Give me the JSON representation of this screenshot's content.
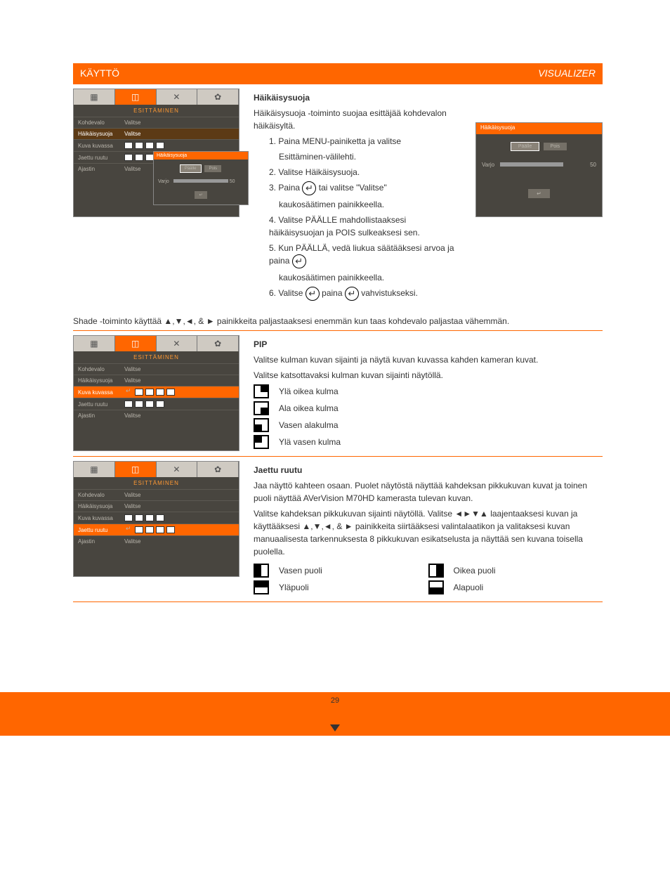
{
  "header": {
    "left": "KÄYTTÖ",
    "right": "VISUALIZER"
  },
  "section1": {
    "title": "Häikäisysuoja",
    "intro": "Häikäisysuoja -toiminto suojaa esittäjää kohdevalon häikäisyltä.",
    "steps": [
      "Paina MENU-painiketta ja valitse",
      "Esittäminen-välilehti.",
      "Valitse Häikäisysuoja.",
      "Paina",
      "tai valitse \"Valitse\"",
      "kaukosäätimen painikkeella.",
      "Valitse PÄÄLLE mahdollistaaksesi häikäisysuojan ja POIS sulkeaksesi sen.",
      "Kun PÄÄLLÄ, vedä liukua säätääksesi arvoa ja paina",
      "kaukosäätimen painikkeella.",
      "Valitse",
      "paina",
      "vahvistukseksi."
    ],
    "shade_note": "Shade -toiminto käyttää ▲,▼,◄, & ► painikkeita paljastaaksesi enemmän kun taas kohdevalo paljastaa vähemmän.",
    "panel_main": {
      "menu_title": "ESITTÄMINEN",
      "rows": [
        {
          "label": "Kohdevalo",
          "val": "Valitse"
        },
        {
          "label": "Häikäisysuoja",
          "val": "Valitse"
        },
        {
          "label": "Kuva kuvassa",
          "val": ""
        },
        {
          "label": "Jaettu ruutu",
          "val": ""
        },
        {
          "label": "Ajastin",
          "val": "Valitse"
        }
      ]
    },
    "popup": {
      "hdr": "Häikäisysuoja",
      "on": "Päälle",
      "off": "Pois",
      "shade_label": "Varjo",
      "shade_val": "50"
    },
    "large_popup": {
      "hdr": "Häikäisysuoja",
      "on": "Päälle",
      "off": "Pois",
      "shade_label": "Varjo",
      "shade_val": "50"
    }
  },
  "section2": {
    "title": "PIP",
    "p1": "Valitse kulman kuvan sijainti ja näytä kuvan kuvassa kahden kameran kuvat.",
    "p2": "Valitse katsottavaksi kulman kuvan sijainti näytöllä.",
    "li": [
      "Ylä oikea kulma",
      "Ala oikea kulma",
      "Vasen alakulma",
      "Ylä vasen kulma"
    ],
    "panel_main": {
      "menu_title": "ESITTÄMINEN",
      "rows": [
        {
          "label": "Kohdevalo",
          "val": "Valitse"
        },
        {
          "label": "Häikäisysuoja",
          "val": "Valitse"
        },
        {
          "label": "Kuva kuvassa",
          "val": ""
        },
        {
          "label": "Jaettu ruutu",
          "val": ""
        },
        {
          "label": "Ajastin",
          "val": "Valitse"
        }
      ]
    }
  },
  "section3": {
    "title": "Jaettu ruutu",
    "p1": "Jaa näyttö kahteen osaan. Puolet näytöstä näyttää kahdeksan pikkukuvan kuvat ja toinen puoli näyttää AVerVision M70HD kamerasta tulevan kuvan.",
    "p2": "Valitse kahdeksan pikkukuvan sijainti näytöllä. Valitse ◄►▼▲ laajentaaksesi kuvan ja käyttääksesi ▲,▼,◄, & ► painikkeita siirtääksesi valintalaatikon ja valitaksesi kuvan manuaalisesta tarkennuksesta 8 pikkukuvan esikatselusta ja näyttää sen kuvana toisella puolella.",
    "li": [
      "Vasen puoli",
      "Yläpuoli",
      "Oikea puoli",
      "Alapuoli"
    ],
    "panel_main": {
      "menu_title": "ESITTÄMINEN",
      "rows": [
        {
          "label": "Kohdevalo",
          "val": "Valitse"
        },
        {
          "label": "Häikäisysuoja",
          "val": "Valitse"
        },
        {
          "label": "Kuva kuvassa",
          "val": ""
        },
        {
          "label": "Jaettu ruutu",
          "val": ""
        },
        {
          "label": "Ajastin",
          "val": "Valitse"
        }
      ]
    }
  },
  "footer": {
    "page": "29"
  }
}
